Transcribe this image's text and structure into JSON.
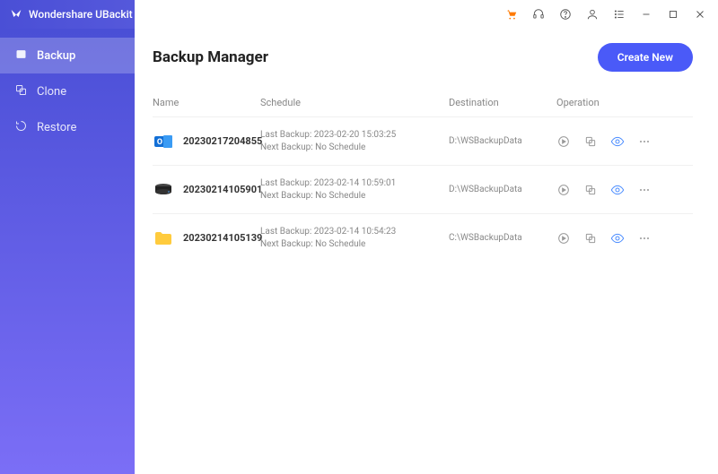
{
  "app_name": "Wondershare UBackit",
  "sidebar": {
    "items": [
      {
        "label": "Backup"
      },
      {
        "label": "Clone"
      },
      {
        "label": "Restore"
      }
    ]
  },
  "header": {
    "title": "Backup Manager",
    "create_label": "Create New"
  },
  "columns": {
    "name": "Name",
    "schedule": "Schedule",
    "destination": "Destination",
    "operation": "Operation"
  },
  "rows": [
    {
      "name": "20230217204855",
      "last": "Last Backup: 2023-02-20 15:03:25",
      "next": "Next Backup: No Schedule",
      "destination": "D:\\WSBackupData"
    },
    {
      "name": "20230214105901",
      "last": "Last Backup: 2023-02-14 10:59:01",
      "next": "Next Backup: No Schedule",
      "destination": "D:\\WSBackupData"
    },
    {
      "name": "20230214105139",
      "last": "Last Backup: 2023-02-14 10:54:23",
      "next": "Next Backup: No Schedule",
      "destination": "C:\\WSBackupData"
    }
  ]
}
